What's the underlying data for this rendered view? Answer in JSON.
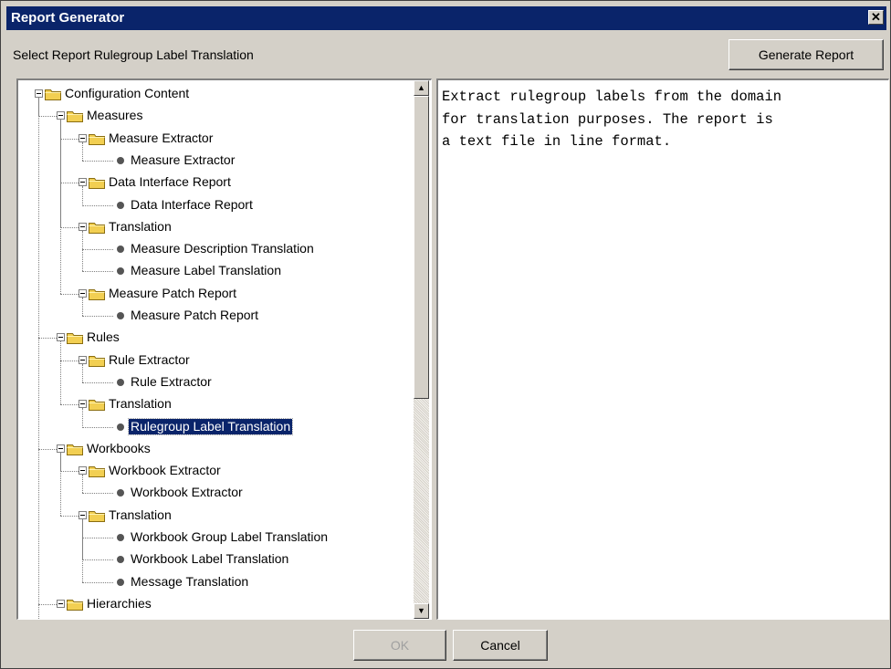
{
  "window": {
    "title": "Report Generator"
  },
  "header": {
    "prompt": "Select Report Rulegroup Label Translation",
    "generate_label": "Generate Report"
  },
  "tree": {
    "nodes": [
      {
        "label": "Configuration Content",
        "type": "folder",
        "level": 0
      },
      {
        "label": "Measures",
        "type": "folder",
        "level": 1
      },
      {
        "label": "Measure Extractor",
        "type": "folder",
        "level": 2
      },
      {
        "label": "Measure Extractor",
        "type": "leaf",
        "level": 3
      },
      {
        "label": "Data Interface Report",
        "type": "folder",
        "level": 2
      },
      {
        "label": "Data Interface Report",
        "type": "leaf",
        "level": 3
      },
      {
        "label": "Translation",
        "type": "folder",
        "level": 2
      },
      {
        "label": "Measure Description Translation",
        "type": "leaf",
        "level": 3
      },
      {
        "label": "Measure Label Translation",
        "type": "leaf",
        "level": 3
      },
      {
        "label": "Measure Patch Report",
        "type": "folder",
        "level": 2
      },
      {
        "label": "Measure Patch Report",
        "type": "leaf",
        "level": 3
      },
      {
        "label": "Rules",
        "type": "folder",
        "level": 1
      },
      {
        "label": "Rule Extractor",
        "type": "folder",
        "level": 2
      },
      {
        "label": "Rule Extractor",
        "type": "leaf",
        "level": 3
      },
      {
        "label": "Translation",
        "type": "folder",
        "level": 2
      },
      {
        "label": "Rulegroup Label Translation",
        "type": "leaf",
        "level": 3,
        "selected": true
      },
      {
        "label": "Workbooks",
        "type": "folder",
        "level": 1
      },
      {
        "label": "Workbook Extractor",
        "type": "folder",
        "level": 2
      },
      {
        "label": "Workbook Extractor",
        "type": "leaf",
        "level": 3
      },
      {
        "label": "Translation",
        "type": "folder",
        "level": 2
      },
      {
        "label": "Workbook Group Label Translation",
        "type": "leaf",
        "level": 3
      },
      {
        "label": "Workbook Label Translation",
        "type": "leaf",
        "level": 3
      },
      {
        "label": "Message Translation",
        "type": "leaf",
        "level": 3
      },
      {
        "label": "Hierarchies",
        "type": "folder",
        "level": 1
      }
    ]
  },
  "description": {
    "text": "Extract rulegroup labels from the domain\nfor translation purposes. The report is\na text file in line format."
  },
  "footer": {
    "ok_label": "OK",
    "cancel_label": "Cancel"
  },
  "colors": {
    "titlebar": "#0a246a",
    "face": "#d4d0c8",
    "selection": "#0a246a",
    "folder": "#f2cf52"
  }
}
